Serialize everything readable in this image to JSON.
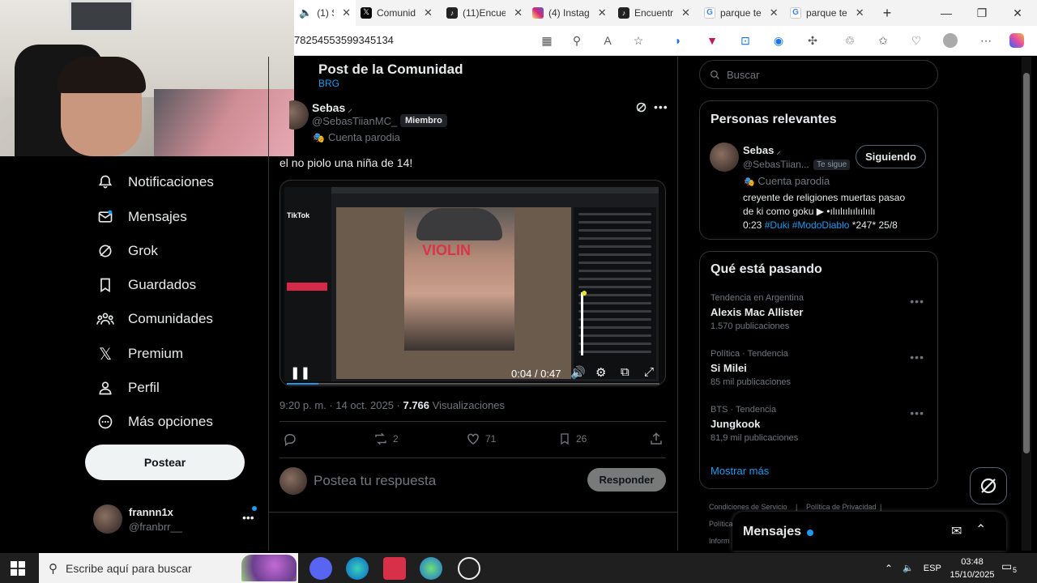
{
  "browser": {
    "tabs": [
      {
        "label": "(1) S",
        "fav_color": "#ffffff",
        "fav": "speaker-icon"
      },
      {
        "label": "Comunid",
        "fav_color": "#000000",
        "fav": "x-logo-icon"
      },
      {
        "label": "(11)Encue",
        "fav_color": "#222222",
        "fav": "tiktok-icon"
      },
      {
        "label": "(4) Instag",
        "fav_color": "#d62976",
        "fav": "instagram-icon"
      },
      {
        "label": "Encuentr",
        "fav_color": "#222222",
        "fav": "tiktok-icon"
      },
      {
        "label": "parque te",
        "fav_color": "#4285f4",
        "fav": "google-icon"
      },
      {
        "label": "parque te",
        "fav_color": "#4285f4",
        "fav": "google-icon"
      }
    ],
    "url": "78254553599345134",
    "new_tab": "+"
  },
  "nav": {
    "items": [
      {
        "label": "Notificaciones",
        "icon": "bell-icon"
      },
      {
        "label": "Mensajes",
        "icon": "mail-icon"
      },
      {
        "label": "Grok",
        "icon": "grok-icon"
      },
      {
        "label": "Guardados",
        "icon": "bookmark-icon"
      },
      {
        "label": "Comunidades",
        "icon": "community-icon"
      },
      {
        "label": "Premium",
        "icon": "x-logo-icon"
      },
      {
        "label": "Perfil",
        "icon": "person-icon"
      },
      {
        "label": "Más opciones",
        "icon": "more-circle-icon"
      }
    ],
    "post_button": "Postear",
    "account": {
      "name": "frannn1x",
      "handle": "@franbrr__"
    }
  },
  "post": {
    "header_title": "Post de la Comunidad",
    "community": "BRG",
    "author_name": "Sebas",
    "author_handle": "@SebasTiianMC_ ·",
    "member_badge": "Miembro",
    "parody_label": "Cuenta parodia",
    "text": "el no piolo una niña de 14!",
    "video": {
      "time": "0:04 / 0:47",
      "overlay_text": "VIOLIN",
      "progress": 0.085,
      "tiktok_label": "TikTok"
    },
    "timestamp": "9:20 p. m. · 14 oct. 2025 ·",
    "views_count": "7.766",
    "views_label": "Visualizaciones",
    "reposts": "2",
    "likes": "71",
    "bookmarks": "26",
    "reply_placeholder": "Postea tu respuesta",
    "reply_button": "Responder"
  },
  "sidebar": {
    "search_placeholder": "Buscar",
    "relevant": {
      "title": "Personas relevantes",
      "name": "Sebas",
      "handle": "@SebasTiian...",
      "follows_you": "Te sigue",
      "follow_button": "Siguiendo",
      "parody_label": "Cuenta parodia",
      "bio_line1": "creyente de religiones muertas pasao",
      "bio_line2": "de ki como goku ▶ •ılıılıılıılıılıılı",
      "bio_time": "0:23",
      "bio_tags": "#Duki #ModoDiablo",
      "bio_tail": "*247* 25/8"
    },
    "trends": {
      "title": "Qué está pasando",
      "items": [
        {
          "category": "Tendencia en Argentina",
          "name": "Alexis Mac Allister",
          "count": "1.570 publicaciones"
        },
        {
          "category": "Política · Tendencia",
          "name": "Si Milei",
          "count": "85 mil publicaciones"
        },
        {
          "category": "BTS · Tendencia",
          "name": "Jungkook",
          "count": "81,9 mil publicaciones"
        }
      ],
      "show_more": "Mostrar más"
    },
    "footer": {
      "terms": "Condiciones de Servicio",
      "privacy": "Política de Privacidad",
      "politica": "Política",
      "info": "Inform"
    },
    "messages_drawer": "Mensajes"
  },
  "taskbar": {
    "search_placeholder": "Escribe aquí para buscar",
    "language": "ESP",
    "time": "03:48",
    "date": "15/10/2025",
    "notif_count": "5"
  }
}
